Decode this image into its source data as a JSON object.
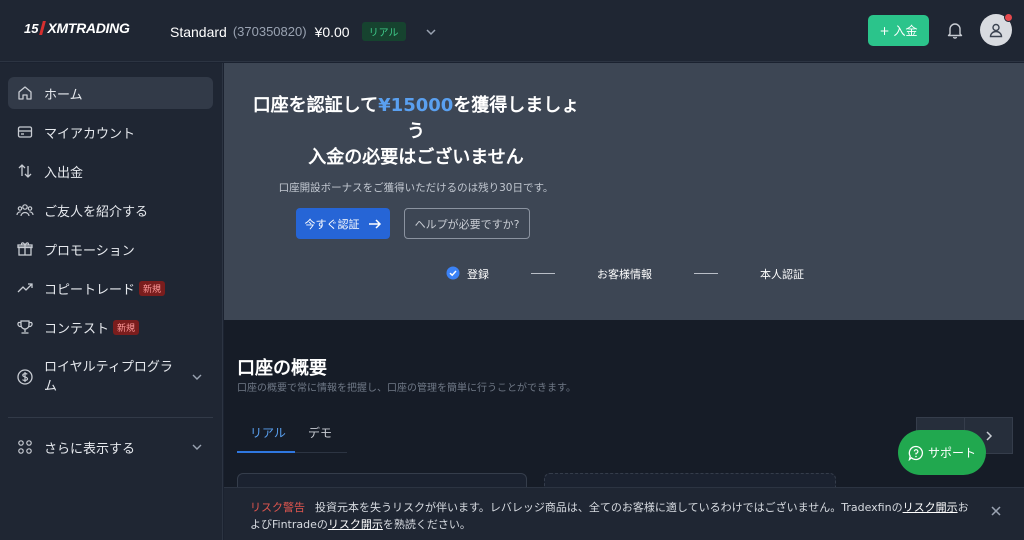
{
  "header": {
    "logo_number": "15",
    "logo_text": "XMTRADING",
    "account_type": "Standard",
    "account_id": "(370350820)",
    "balance": "¥0.00",
    "account_badge": "リアル",
    "deposit_label": "入金",
    "deposit_plus": "+"
  },
  "sidebar": {
    "items": [
      {
        "label": "ホーム",
        "icon": "home-icon"
      },
      {
        "label": "マイアカウント",
        "icon": "wallet-icon"
      },
      {
        "label": "入出金",
        "icon": "transfer-icon"
      },
      {
        "label": "ご友人を紹介する",
        "icon": "people-icon"
      },
      {
        "label": "プロモーション",
        "icon": "gift-icon"
      },
      {
        "label": "コピートレード",
        "icon": "trend-icon",
        "badge": "新規"
      },
      {
        "label": "コンテスト",
        "icon": "trophy-icon",
        "badge": "新規"
      },
      {
        "label_line1": "ロイヤルティプログラ",
        "label_line2": "ム",
        "icon": "dollar-icon"
      }
    ],
    "more_label": "さらに表示する"
  },
  "hero": {
    "title_prefix": "口座を認証して",
    "title_amount": "¥15000",
    "title_suffix_line1": "を獲得しましょ",
    "title_line2": "う",
    "title_line3": "入金の必要はございません",
    "subtitle": "口座開設ボーナスをご獲得いただけるのは残り30日です。",
    "verify_button": "今すぐ認証",
    "help_button": "ヘルプが必要ですか?",
    "steps": [
      "登録",
      "お客様情報",
      "本人認証"
    ]
  },
  "overview": {
    "title": "口座の概要",
    "subtitle": "口座の概要で常に情報を把握し、口座の管理を簡単に行うことができます。",
    "tabs": [
      "リアル",
      "デモ"
    ],
    "support_label": "サポート"
  },
  "risk": {
    "label": "リスク警告",
    "text1": "投資元本を失うリスクが伴います。レバレッジ商品は、全てのお客様に適しているわけではございません。Tradexfinの",
    "link1": "リスク開示",
    "text2": "お",
    "text3": "よびFintradeの",
    "link2": "リスク開示",
    "text4": "を熟読ください。"
  }
}
